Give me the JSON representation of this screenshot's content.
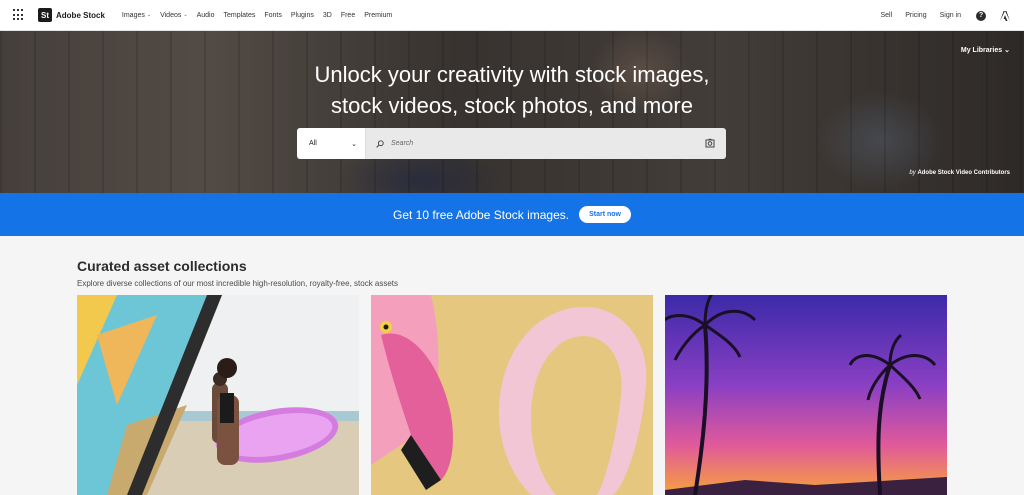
{
  "nav": {
    "brand": "Adobe Stock",
    "brand_short": "St",
    "links": [
      {
        "label": "Images",
        "dropdown": true
      },
      {
        "label": "Videos",
        "dropdown": true
      },
      {
        "label": "Audio",
        "dropdown": false
      },
      {
        "label": "Templates",
        "dropdown": false
      },
      {
        "label": "Fonts",
        "dropdown": false
      },
      {
        "label": "Plugins",
        "dropdown": false
      },
      {
        "label": "3D",
        "dropdown": false
      },
      {
        "label": "Free",
        "dropdown": false
      },
      {
        "label": "Premium",
        "dropdown": false
      }
    ],
    "right": {
      "sell": "Sell",
      "pricing": "Pricing",
      "sign_in": "Sign in",
      "help": "?"
    }
  },
  "hero": {
    "title_line1": "Unlock your creativity with stock images,",
    "title_line2": "stock videos, stock photos, and more",
    "my_libraries": "My Libraries",
    "credit_by": "by",
    "credit_name": "Adobe Stock Video Contributors",
    "search": {
      "type_selected": "All",
      "placeholder": "Search"
    }
  },
  "promo": {
    "text": "Get 10 free Adobe Stock images.",
    "button": "Start now",
    "color": "#1473e6"
  },
  "collections": {
    "title": "Curated asset collections",
    "subtitle": "Explore diverse collections of our most incredible high-resolution, royalty-free, stock assets"
  },
  "icons": {
    "apps": "app-grid-icon",
    "help": "help-icon",
    "adobe": "adobe-logo-icon",
    "search": "search-icon",
    "visual_search": "camera-search-icon"
  }
}
